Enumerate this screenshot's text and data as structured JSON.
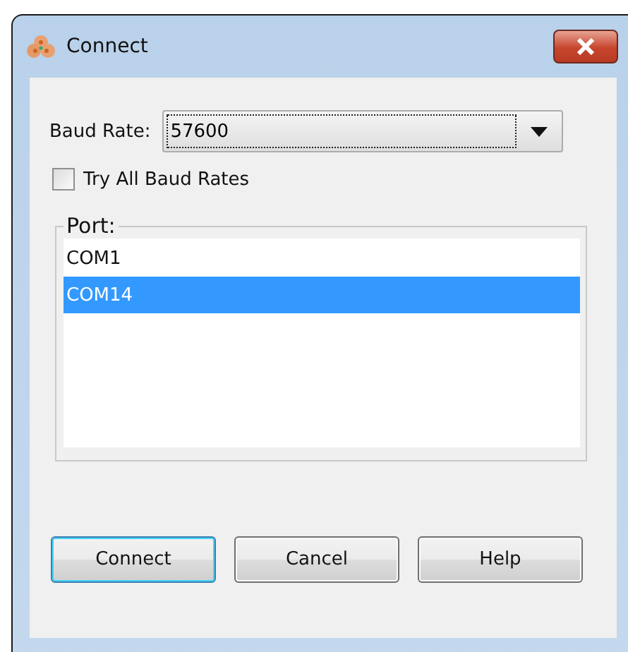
{
  "window": {
    "title": "Connect"
  },
  "baud_rate": {
    "label": "Baud Rate:",
    "value": "57600"
  },
  "try_all": {
    "label": "Try All Baud Rates",
    "checked": false
  },
  "port": {
    "legend": "Port:",
    "items": [
      {
        "label": "COM1",
        "selected": false
      },
      {
        "label": "COM14",
        "selected": true
      }
    ]
  },
  "buttons": [
    {
      "label": "Connect",
      "default": true
    },
    {
      "label": "Cancel",
      "default": false
    },
    {
      "label": "Help",
      "default": false
    }
  ]
}
